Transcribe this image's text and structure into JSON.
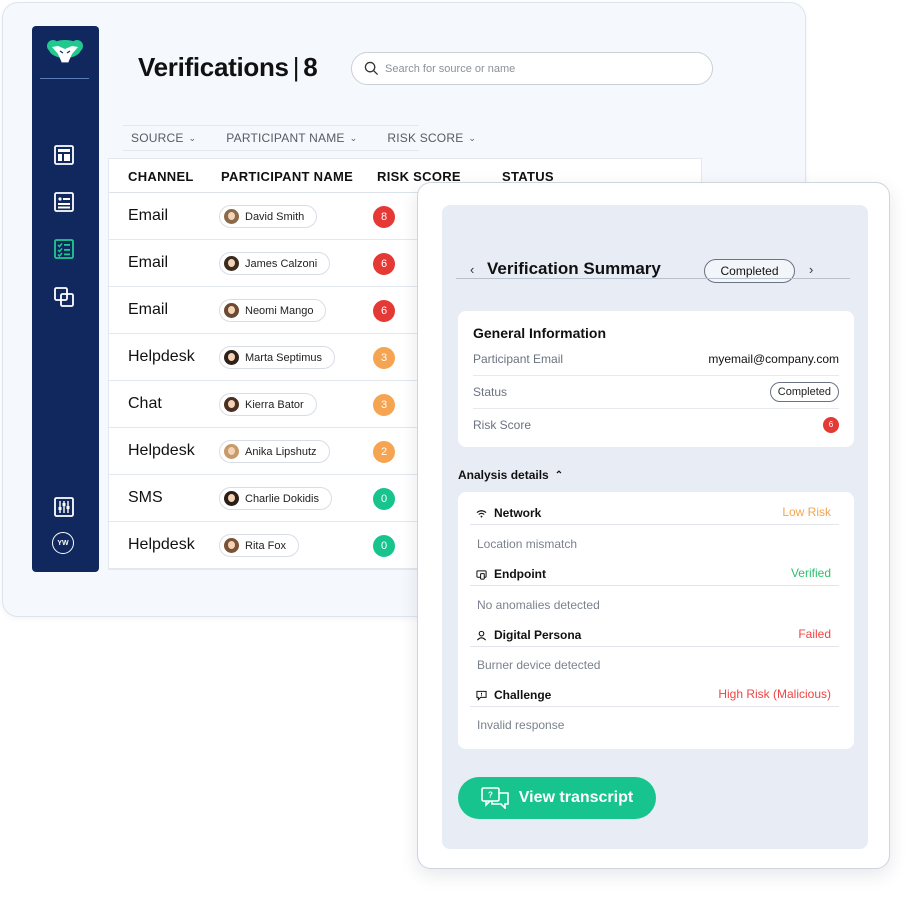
{
  "header": {
    "title": "Verifications",
    "separator": "|",
    "count": "8"
  },
  "search": {
    "placeholder": "Search for source or name"
  },
  "filters": [
    {
      "label": "SOURCE"
    },
    {
      "label": "PARTICIPANT NAME"
    },
    {
      "label": "RISK SCORE"
    }
  ],
  "sidebar": {
    "logo_icon": "sheep-logo-icon",
    "items": [
      {
        "icon": "dashboard-icon",
        "active": false
      },
      {
        "icon": "id-card-icon",
        "active": false
      },
      {
        "icon": "checklist-icon",
        "active": true
      },
      {
        "icon": "copy-icon",
        "active": false
      }
    ],
    "settings_icon": "sliders-icon",
    "user_initials": "YW"
  },
  "table": {
    "columns": [
      "CHANNEL",
      "PARTICIPANT NAME",
      "RISK SCORE",
      "STATUS"
    ],
    "rows": [
      {
        "channel": "Email",
        "name": "David Smith",
        "score": "8",
        "score_color": "#e53935",
        "hair": "#8a6a4a"
      },
      {
        "channel": "Email",
        "name": "James Calzoni",
        "score": "6",
        "score_color": "#e53935",
        "hair": "#3b2a1e"
      },
      {
        "channel": "Email",
        "name": "Neomi Mango",
        "score": "6",
        "score_color": "#e53935",
        "hair": "#6b4a32"
      },
      {
        "channel": "Helpdesk",
        "name": "Marta Septimus",
        "score": "3",
        "score_color": "#f5a552",
        "hair": "#2e211a"
      },
      {
        "channel": "Chat",
        "name": "Kierra Bator",
        "score": "3",
        "score_color": "#f5a552",
        "hair": "#4a2e1f"
      },
      {
        "channel": "Helpdesk",
        "name": "Anika Lipshutz",
        "score": "2",
        "score_color": "#f5a552",
        "hair": "#c79a6a"
      },
      {
        "channel": "SMS",
        "name": "Charlie Dokidis",
        "score": "0",
        "score_color": "#18c48d",
        "hair": "#2a1e16"
      },
      {
        "channel": "Helpdesk",
        "name": "Rita Fox",
        "score": "0",
        "score_color": "#18c48d",
        "hair": "#7a5236"
      }
    ]
  },
  "summary": {
    "title": "Verification Summary",
    "status": "Completed",
    "general": {
      "title": "General Information",
      "email_label": "Participant Email",
      "email_value": "myemail@company.com",
      "status_label": "Status",
      "status_value": "Completed",
      "risk_label": "Risk Score",
      "risk_value": "6"
    },
    "analysis_label": "Analysis details",
    "analysis": [
      {
        "icon": "wifi-icon",
        "name": "Network",
        "status": "Low Risk",
        "status_color": "#f5a552",
        "detail": "Location mismatch"
      },
      {
        "icon": "device-icon",
        "name": "Endpoint",
        "status": "Verified",
        "status_color": "#2fbf6d",
        "detail": "No anomalies detected"
      },
      {
        "icon": "user-icon",
        "name": "Digital Persona",
        "status": "Failed",
        "status_color": "#ef4444",
        "detail": "Burner device detected"
      },
      {
        "icon": "chat-icon",
        "name": "Challenge",
        "status": "High Risk (Malicious)",
        "status_color": "#ef4444",
        "detail": "Invalid response"
      }
    ],
    "transcript_button": "View transcript"
  },
  "colors": {
    "sidebar": "#10285e",
    "accent": "#18c48d",
    "danger": "#e53935",
    "warning": "#f5a552"
  }
}
